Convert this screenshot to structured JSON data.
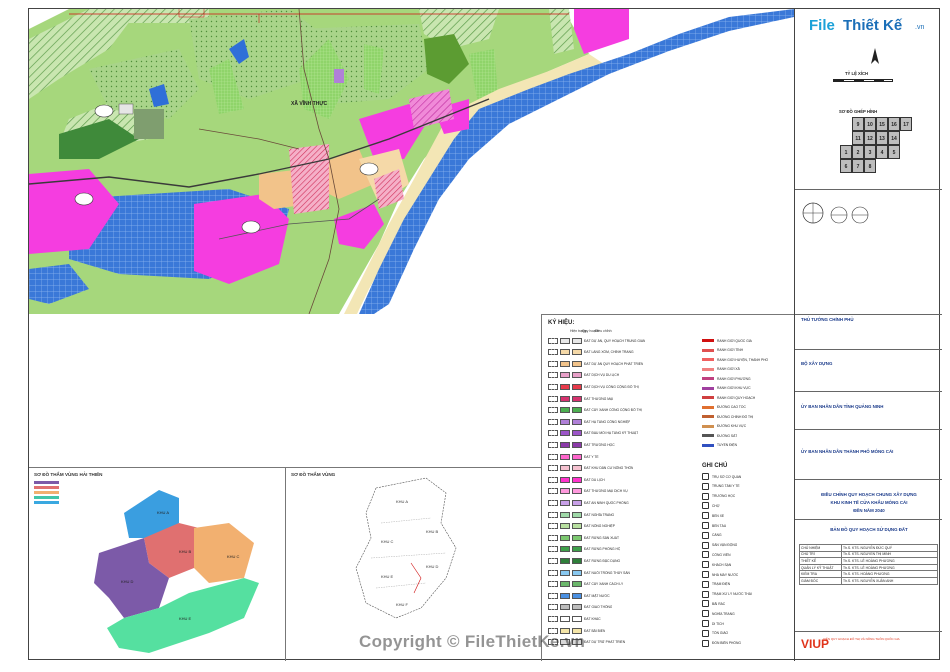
{
  "map": {
    "place_label": "XÃ VĨNH THỰC"
  },
  "legend": {
    "title": "KÝ HIỆU:",
    "col_heads": [
      "Hiện trạng",
      "Quy hoạch",
      "Điều chỉnh"
    ],
    "items_left": [
      {
        "label": "ĐẤT DỰ ÁN, QUY HOẠCH TRUNG GIAN",
        "color": "#e8e8e8"
      },
      {
        "label": "ĐẤT LÀNG XÓM, CHỈNH TRANG",
        "color": "#f5d9a8"
      },
      {
        "label": "ĐẤT DỰ ÁN QUY HOẠCH PHÁT TRIỂN",
        "color": "#f2c38a"
      },
      {
        "label": "ĐẤT DỊCH VỤ DU LỊCH",
        "color": "#e8a0c8"
      },
      {
        "label": "ĐẤT DỊCH VỤ CÔNG CỘNG ĐÔ THỊ",
        "color": "#e83a4a"
      },
      {
        "label": "ĐẤT THƯƠNG MẠI",
        "color": "#d6326e"
      },
      {
        "label": "ĐẤT CÂY XANH CÔNG CỘNG ĐÔ THỊ",
        "color": "#4caf50"
      },
      {
        "label": "ĐẤT HẠ TẦNG CÔNG NGHIỆP",
        "color": "#b080d8"
      },
      {
        "label": "ĐẤT ĐẦU MỐI HẠ TẦNG KỸ THUẬT",
        "color": "#9c55c8"
      },
      {
        "label": "ĐẤT TRƯỜNG HỌC",
        "color": "#8b3aa8"
      },
      {
        "label": "ĐẤT Y TẾ",
        "color": "#ff66cc"
      },
      {
        "label": "ĐẤT KHU DÂN CƯ NÔNG THÔN",
        "color": "#f5c2d0"
      },
      {
        "label": "ĐẤT DU LỊCH",
        "color": "#ff33cc"
      },
      {
        "label": "ĐẤT THƯƠNG MẠI DỊCH VỤ",
        "color": "#ff99dd"
      },
      {
        "label": "ĐẤT AN NINH QUỐC PHÒNG",
        "color": "#c8a0e8"
      },
      {
        "label": "ĐẤT NGHĨA TRANG",
        "color": "#9fd9a8"
      },
      {
        "label": "ĐẤT NÔNG NGHIỆP",
        "color": "#b8e0a0"
      },
      {
        "label": "ĐẤT RỪNG SẢN XUẤT",
        "color": "#7cc870"
      },
      {
        "label": "ĐẤT RỪNG PHÒNG HỘ",
        "color": "#3ea04a"
      },
      {
        "label": "ĐẤT RỪNG ĐẶC DỤNG",
        "color": "#2f7f3a"
      },
      {
        "label": "ĐẤT NUÔI TRỒNG THỦY SẢN",
        "color": "#88c8f0"
      },
      {
        "label": "ĐẤT CÂY XANH CÁCH LY",
        "color": "#6cb86c"
      },
      {
        "label": "ĐẤT MẶT NƯỚC",
        "color": "#4a90e2"
      },
      {
        "label": "ĐẤT GIAO THÔNG",
        "color": "#bdbdbd"
      },
      {
        "label": "ĐẤT KHÁC",
        "color": "#ffffff"
      },
      {
        "label": "ĐẤT BÃI BIỂN",
        "color": "#f5e6a8"
      },
      {
        "label": "ĐẤT DỰ TRỮ PHÁT TRIỂN",
        "color": "#d8d8d8"
      }
    ],
    "items_right": [
      {
        "label": "RANH GIỚI QUỐC GIA",
        "color": "#d01010"
      },
      {
        "label": "RANH GIỚI TỈNH",
        "color": "#e05050"
      },
      {
        "label": "RANH GIỚI HUYỆN, THÀNH PHỐ",
        "color": "#f06060"
      },
      {
        "label": "RANH GIỚI XÃ",
        "color": "#f08080"
      },
      {
        "label": "RANH GIỚI PHƯỜNG",
        "color": "#c04080"
      },
      {
        "label": "RANH GIỚI KHU VỰC",
        "color": "#a040a0"
      },
      {
        "label": "RANH GIỚI QUY HOẠCH",
        "color": "#d04040"
      },
      {
        "label": "ĐƯỜNG CAO TỐC",
        "color": "#e07030"
      },
      {
        "label": "ĐƯỜNG CHÍNH ĐÔ THỊ",
        "color": "#c06030"
      },
      {
        "label": "ĐƯỜNG KHU VỰC",
        "color": "#d09050"
      },
      {
        "label": "ĐƯỜNG SẮT",
        "color": "#555555"
      },
      {
        "label": "TUYẾN ĐIỆN",
        "color": "#3050c0"
      }
    ],
    "ghichu_title": "GHI CHÚ",
    "ghichu_items": [
      "TRỤ SỞ CƠ QUAN",
      "TRUNG TÂM Y TẾ",
      "TRƯỜNG HỌC",
      "CHỢ",
      "BẾN XE",
      "BẾN TÀU",
      "CẢNG",
      "SÂN VẬN ĐỘNG",
      "CÔNG VIÊN",
      "KHÁCH SẠN",
      "NHÀ MÁY NƯỚC",
      "TRẠM ĐIỆN",
      "TRẠM XỬ LÝ NƯỚC THẢI",
      "BÃI RÁC",
      "NGHĨA TRANG",
      "DI TÍCH",
      "TÔN GIÁO",
      "ĐỒN BIÊN PHÒNG"
    ]
  },
  "submap_left": {
    "title": "SƠ ĐỒ THẨM VÙNG HẢI THIẾN",
    "zones": [
      "KHU A",
      "KHU B",
      "KHU C",
      "KHU D",
      "KHU E"
    ]
  },
  "submap_right": {
    "title": "SƠ ĐỒ THẨM VÙNG",
    "zones": [
      "KHU A",
      "KHU B",
      "KHU C",
      "KHU D",
      "KHU E",
      "KHU F"
    ]
  },
  "titleblock": {
    "logo_part1": "File",
    "logo_part2": "Thiết Kế",
    "logo_part3": ".vn",
    "scale_label": "TỶ LỆ XÍCH",
    "grid_label": "SƠ ĐỒ GHÉP HÌNH",
    "grid_cells": [
      "9",
      "10",
      "15",
      "16",
      "17",
      "11",
      "12",
      "13",
      "14",
      "1",
      "2",
      "3",
      "4",
      "5",
      "6",
      "7",
      "8"
    ],
    "approval": "THỦ TƯỚNG CHÍNH PHỦ",
    "ministry": "BỘ XÂY DỰNG",
    "province": "ỦY BAN NHÂN DÂN TỈNH QUẢNG NINH",
    "city": "ỦY BAN NHÂN DÂN THÀNH PHỐ MÓNG CÁI",
    "project_line1": "ĐIỀU CHỈNH QUY HOẠCH CHUNG XÂY DỰNG",
    "project_line2": "KHU KINH TẾ CỬA KHẨU MÓNG CÁI",
    "project_line3": "ĐẾN NĂM 2040",
    "drawing_title": "BẢN ĐỒ QUY HOẠCH SỬ DỤNG ĐẤT",
    "staff": [
      [
        "CHỦ NHIỆM",
        "Th.S. KTS. NGUYỄN ĐỨC QUÝ"
      ],
      [
        "CHỦ TRÌ",
        "Th.S. KTS. NGUYỄN THỊ MINH"
      ],
      [
        "THIẾT KẾ",
        "Th.S. KTS. LÊ HOÀNG PHƯƠNG"
      ],
      [
        "QUẢN LÝ KỸ THUẬT",
        "Th.S. KTS. LÊ HOÀNG PHƯƠNG"
      ],
      [
        "KIỂM TRA",
        "Th.S. KTS. HOÀNG PHƯƠNG"
      ],
      [
        "GIÁM ĐỐC",
        "Th.S. KTS. NGUYỄN XUÂN ANH"
      ]
    ],
    "company": "VIUP",
    "company_sub": "VIỆN QUY HOẠCH ĐÔ THỊ VÀ NÔNG THÔN QUỐC GIA"
  },
  "watermark": "Copyright © FileThietKe.vn"
}
